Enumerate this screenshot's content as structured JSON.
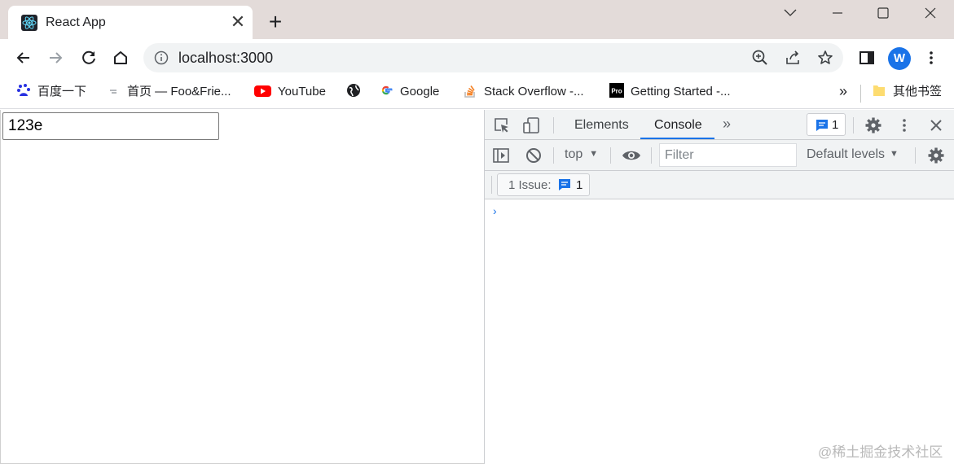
{
  "browser": {
    "tab": {
      "title": "React App",
      "close_glyph": "✕"
    },
    "new_tab_glyph": "+",
    "address_bar": {
      "url": "localhost:3000"
    },
    "profile_initial": "W"
  },
  "bookmarks": [
    {
      "label": "百度一下",
      "icon": "baidu-icon"
    },
    {
      "label": "首页 — Foo&Frie...",
      "icon": "page-icon"
    },
    {
      "label": "YouTube",
      "icon": "youtube-icon"
    },
    {
      "label": "",
      "icon": "globe-icon"
    },
    {
      "label": "Google",
      "icon": "google-icon"
    },
    {
      "label": "Stack Overflow -...",
      "icon": "stackoverflow-icon"
    },
    {
      "label": "Getting Started -...",
      "icon": "pro-icon"
    }
  ],
  "bookmarks_more_glyph": "»",
  "other_bookmarks": {
    "label": "其他书签",
    "icon": "folder-icon"
  },
  "page": {
    "input_value": "123e"
  },
  "devtools": {
    "tabs": [
      {
        "label": "Elements",
        "active": false
      },
      {
        "label": "Console",
        "active": true
      }
    ],
    "more_tabs_glyph": "»",
    "issues_badge_count": "1",
    "context": "top",
    "filter_placeholder": "Filter",
    "levels": "Default levels",
    "issues_label": "1 Issue:",
    "issues_count": "1",
    "prompt": "›"
  },
  "watermark": "@稀土掘金技术社区",
  "colors": {
    "accent": "#1a73e8",
    "titlebar": "#e3dbd9",
    "youtube": "#ff0000"
  }
}
